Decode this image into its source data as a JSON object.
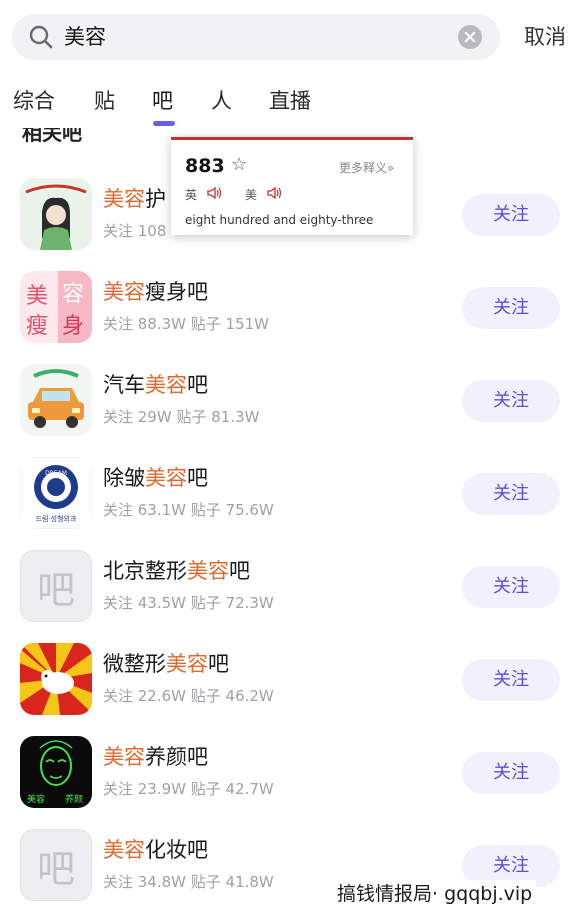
{
  "search": {
    "query": "美容",
    "cancel_label": "取消"
  },
  "tabs": [
    {
      "label": "综合"
    },
    {
      "label": "贴"
    },
    {
      "label": "吧"
    },
    {
      "label": "人"
    },
    {
      "label": "直播"
    }
  ],
  "active_tab": "吧",
  "section_title": "相关吧",
  "list": [
    {
      "name_hl": "美容",
      "name_rest": "护",
      "stats": "关注 108",
      "follow_label": "关注"
    },
    {
      "name_hl": "美容",
      "name_rest": "瘦身吧",
      "stats": "关注 88.3W 贴子 151W",
      "follow_label": "关注"
    },
    {
      "name_pre": "汽车",
      "name_hl": "美容",
      "name_rest": "吧",
      "stats": "关注 29W 贴子 81.3W",
      "follow_label": "关注"
    },
    {
      "name_pre": "除皱",
      "name_hl": "美容",
      "name_rest": "吧",
      "stats": "关注 63.1W 贴子 75.6W",
      "follow_label": "关注"
    },
    {
      "name_pre": "北京整形",
      "name_hl": "美容",
      "name_rest": "吧",
      "stats": "关注 43.5W 贴子 72.3W",
      "follow_label": "关注",
      "avatar_char": "吧"
    },
    {
      "name_pre": "微整形",
      "name_hl": "美容",
      "name_rest": "吧",
      "stats": "关注 22.6W 贴子 46.2W",
      "follow_label": "关注"
    },
    {
      "name_hl": "美容",
      "name_rest": "养颜吧",
      "stats": "关注 23.9W 贴子 42.7W",
      "follow_label": "关注"
    },
    {
      "name_hl": "美容",
      "name_rest": "化妆吧",
      "stats": "关注 34.8W 贴子 41.8W",
      "follow_label": "关注",
      "avatar_char": "吧"
    }
  ],
  "avatar_texts": {
    "beauty_slim": [
      "美",
      "容",
      "瘦",
      "身"
    ],
    "dream_badge": "DREAM",
    "dream_caption": "드림·성형외과",
    "yangyan_caption": [
      "美容",
      "养颜"
    ]
  },
  "dict_popup": {
    "word": "883",
    "more_label": "更多释义»",
    "uk_label": "英",
    "us_label": "美",
    "definition": "eight hundred and eighty-three"
  },
  "watermark": "搞钱情报局· gqqbj.vip",
  "colors": {
    "accent": "#6b5cf0",
    "highlight": "#e0692d",
    "follow_bg": "#f2f0fd",
    "popup_border": "#c0332b"
  }
}
